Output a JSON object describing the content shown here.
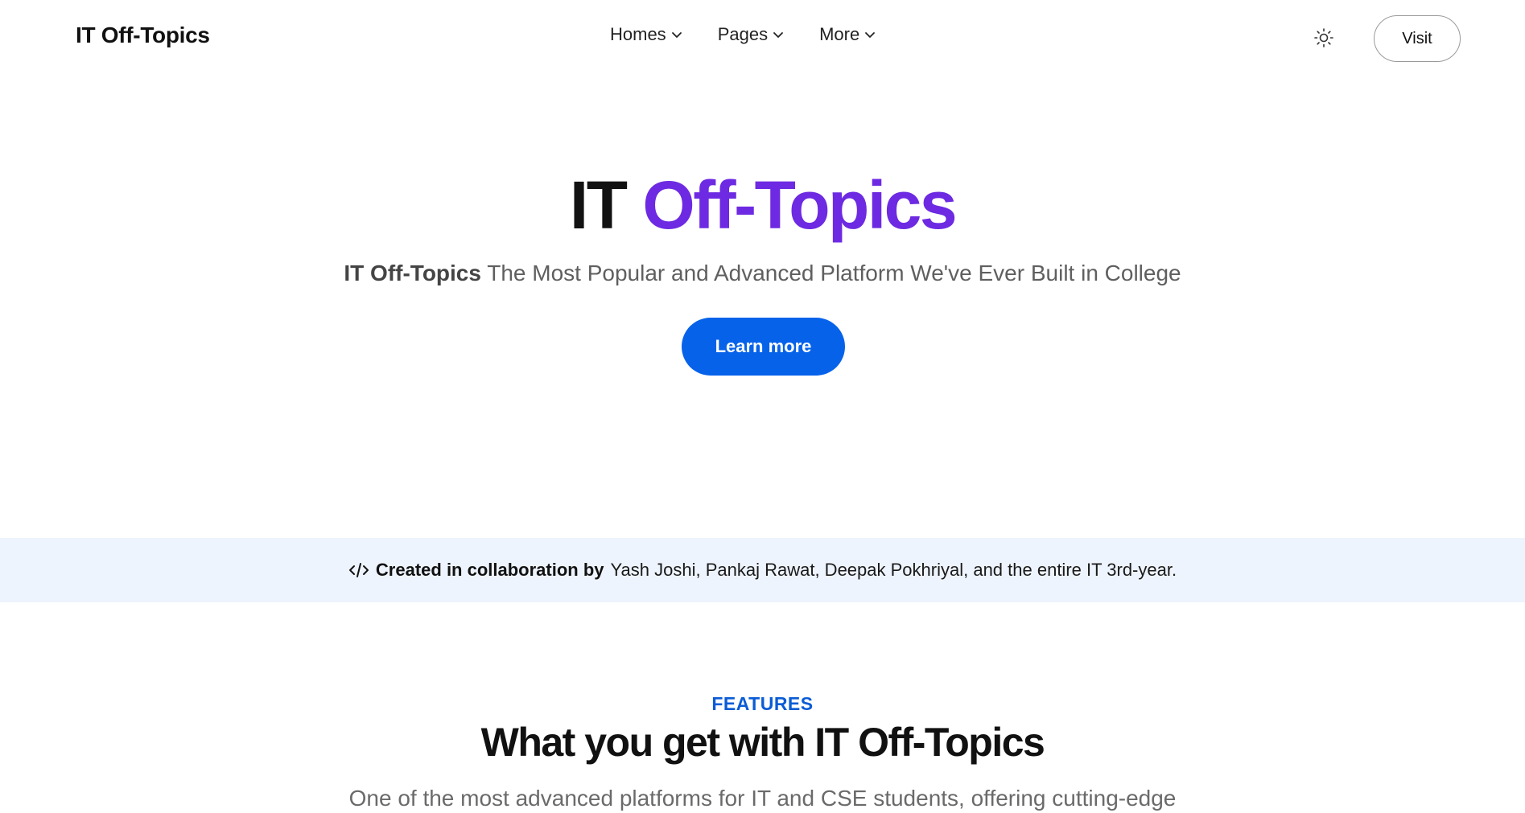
{
  "navbar": {
    "brand": "IT Off-Topics",
    "menu": [
      {
        "label": "Homes"
      },
      {
        "label": "Pages"
      },
      {
        "label": "More"
      }
    ],
    "theme_icon": "sun-icon",
    "visit_label": "Visit"
  },
  "hero": {
    "title_plain": "IT",
    "title_accent": "Off-Topics",
    "subtitle_bold": "IT Off-Topics",
    "subtitle_rest": "The Most Popular and Advanced Platform We've Ever Built in College",
    "cta_label": "Learn more"
  },
  "collab": {
    "icon": "code-icon",
    "bold": "Created in collaboration by",
    "text": "Yash Joshi, Pankaj Rawat, Deepak Pokhriyal, and the entire IT 3rd-year."
  },
  "features": {
    "eyebrow": "FEATURES",
    "title": "What you get with IT Off-Topics",
    "description": "One of the most advanced platforms for IT and CSE students, offering cutting-edge"
  },
  "colors": {
    "accent_purple": "#6d2ae2",
    "primary_blue": "#0762ea",
    "eyebrow_blue": "#0b5cd5",
    "band_bg": "#eef4fd"
  }
}
